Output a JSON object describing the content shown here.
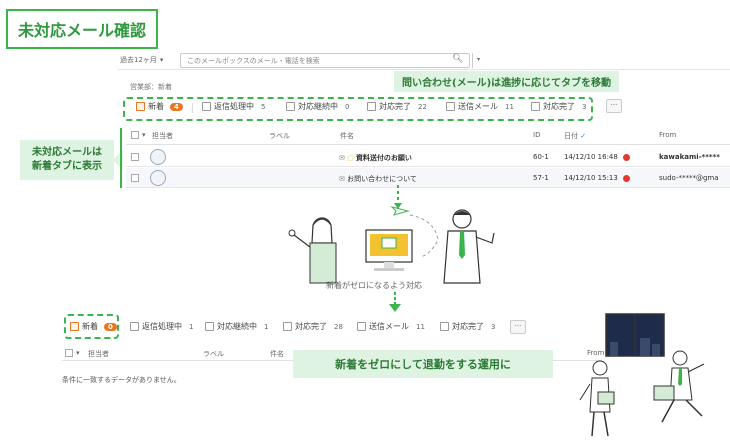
{
  "title": "未対応メール確認",
  "filter": {
    "period": "過去12ヶ月",
    "search_placeholder": "このメールボックスのメール・電話を検索"
  },
  "breadcrumb": "営業部：新着",
  "callouts": {
    "tabs": "問い合わせ(メール)は進捗に応じてタブを移動",
    "side_line1": "未対応メールは",
    "side_line2": "新着タブに表示",
    "bottom": "新着をゼロにして退勤をする運用に"
  },
  "tabs_top": [
    {
      "label": "新着",
      "count": "4",
      "highlight": true
    },
    {
      "label": "返信処理中",
      "count": "5"
    },
    {
      "label": "対応継続中",
      "count": "0"
    },
    {
      "label": "対応完了",
      "count": "22"
    },
    {
      "label": "送信メール",
      "count": "11"
    },
    {
      "label": "対応完了",
      "count": "3"
    }
  ],
  "more_label": "···",
  "columns": {
    "assignee": "担当者",
    "label": "ラベル",
    "subject": "件名",
    "id": "ID",
    "date": "日付",
    "from": "From"
  },
  "rows": [
    {
      "subject": "資料送付のお願い",
      "id": "60-1",
      "date": "14/12/10 16:48",
      "from": "kawakami-*****",
      "bold": true
    },
    {
      "subject": "お問い合わせについて",
      "id": "57-1",
      "date": "14/12/10 15:13",
      "from": "sudo-*****@gma",
      "bold": false
    }
  ],
  "mid_caption": "新着がゼロになるよう対応",
  "tabs_bottom": [
    {
      "label": "新着",
      "count": "0",
      "highlight": true
    },
    {
      "label": "返信処理中",
      "count": "1"
    },
    {
      "label": "対応継続中",
      "count": "1"
    },
    {
      "label": "対応完了",
      "count": "28"
    },
    {
      "label": "送信メール",
      "count": "11"
    },
    {
      "label": "対応完了",
      "count": "3"
    }
  ],
  "columns_bottom": {
    "assignee": "担当者",
    "label": "ラベル",
    "subject": "件名",
    "from": "From"
  },
  "empty_message": "条件に一致するデータがありません。",
  "colors": {
    "accent": "#3bb44a",
    "callout_bg": "#def3e1",
    "badge": "#e87722",
    "alert": "#e03a2f"
  }
}
